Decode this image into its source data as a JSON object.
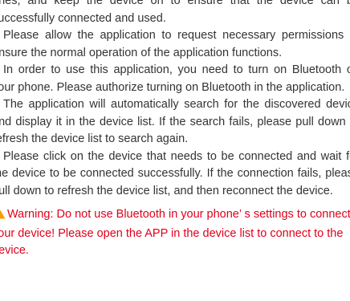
{
  "paragraphs": [
    "ones, and keep the device on to ensure that the device can be successfully connected and used.",
    "Please allow the application to request necessary permissions to ensure the normal operation of the application functions.",
    "In order to use this application, you need to turn on Bluetooth on your phone. Please authorize turning on Bluetooth in the application.",
    "The application will automatically search for the discovered device and display it in the device list. If the search fails, please pull down to refresh the device list to search again.",
    "Please click on the device that needs to be connected and wait for the device to be connected successfully. If the connection fails, please pull down to refresh the device list, and then reconnect the device."
  ],
  "warning": {
    "icon": "warning-triangle-icon",
    "color": "#e0001b",
    "text": "Warning: Do not use Bluetooth in your phone’ s settings to connect your device! Please open the APP in the device list to connect to the device."
  }
}
